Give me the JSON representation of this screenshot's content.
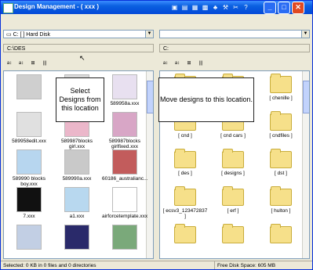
{
  "window": {
    "title": "Design Management  -  ( xxx )",
    "toolbar_icons": [
      "folder-open-icon",
      "folder-icon",
      "save-icon",
      "print-icon",
      "network-icon",
      "tools-icon",
      "scissors-icon",
      "help-icon"
    ],
    "toolbar_glyphs": [
      "▣",
      "▤",
      "▦",
      "▩",
      "♣",
      "⚒",
      "✂",
      "?"
    ],
    "caption_min": "_",
    "caption_max": "□",
    "caption_close": "✕"
  },
  "left": {
    "drive": "C: [ ] Hard Disk",
    "path": "C:\\DES",
    "toolbar_glyphs": [
      "a↕",
      "a↕",
      "⊞",
      "|||"
    ],
    "items": [
      {
        "label": "",
        "thumb": "#cfcfcf"
      },
      {
        "label": "",
        "thumb": "#d8d8d8"
      },
      {
        "label": "589958a.xxx",
        "thumb": "#e8e0f0"
      },
      {
        "label": "589958edit.xxx",
        "thumb": "#e0e0e0"
      },
      {
        "label": "589987blocks girl.xxx",
        "thumb": "#ebb7ca"
      },
      {
        "label": "589987blocks girlfixed.xxx",
        "thumb": "#d8a6c6"
      },
      {
        "label": "589990 blocks boy.xxx",
        "thumb": "#b7d6ef"
      },
      {
        "label": "589990a.xxx",
        "thumb": "#c9c9c9"
      },
      {
        "label": "60186_australianc...",
        "thumb": "#c25c5c"
      },
      {
        "label": "7.xxx",
        "thumb": "#111111"
      },
      {
        "label": "a1.xxx",
        "thumb": "#b8d8ef"
      },
      {
        "label": "airforcetemplate.xxx",
        "thumb": "#ffffff"
      },
      {
        "label": "",
        "thumb": "#c2cfe4"
      },
      {
        "label": "",
        "thumb": "#2a2a6a"
      },
      {
        "label": "",
        "thumb": "#7aa97a"
      }
    ],
    "callout": "Select Designs from this location"
  },
  "right": {
    "drive": "",
    "path": "C:",
    "toolbar_glyphs": [
      "a↕",
      "a↕",
      "⊞",
      "|||"
    ],
    "items": [
      {
        "label": ""
      },
      {
        "label": ""
      },
      {
        "label": "[ chenille ]"
      },
      {
        "label": "[ cnd ]"
      },
      {
        "label": "[ cnd cars ]"
      },
      {
        "label": "[ cndfiles ]"
      },
      {
        "label": "[ des ]"
      },
      {
        "label": "[ designs ]"
      },
      {
        "label": "[ dst ]"
      },
      {
        "label": "[ ecsv3_123472837 ]"
      },
      {
        "label": "[ erf ]"
      },
      {
        "label": "[ hulton ]"
      },
      {
        "label": ""
      },
      {
        "label": ""
      },
      {
        "label": ""
      }
    ],
    "callout": "Move designs to this location."
  },
  "status": {
    "left": "Selected: 0 KB in 0 files and 0 directories",
    "right": "Free Disk Space: 605 MB"
  }
}
